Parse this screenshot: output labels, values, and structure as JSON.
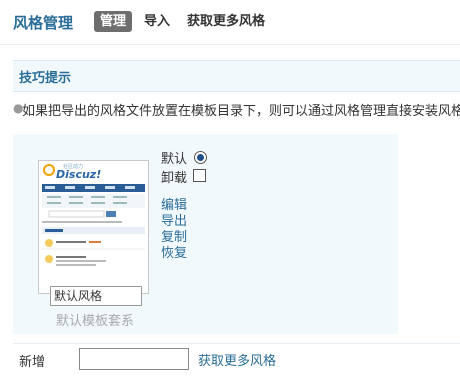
{
  "header": {
    "title": "风格管理",
    "tabs": [
      {
        "label": "管理",
        "active": true
      },
      {
        "label": "导入",
        "active": false
      },
      {
        "label": "获取更多风格",
        "active": false
      }
    ]
  },
  "tips": {
    "title": "技巧提示",
    "line": "如果把导出的风格文件放置在模板目录下，则可以通过风格管理直接安装风格"
  },
  "style": {
    "name_value": "默认风格",
    "subtitle": "默认模板套系",
    "options": {
      "default_label": "默认",
      "default_selected": true,
      "uninstall_label": "卸载",
      "uninstall_checked": false
    },
    "actions": [
      "编辑",
      "导出",
      "复制",
      "恢复"
    ],
    "thumbnail": {
      "brand": "Discuz!",
      "brand_sub": "社区动力",
      "icon": "discuz-forum-preview"
    }
  },
  "new": {
    "label": "新增",
    "input_value": "",
    "more_link": "获取更多风格"
  },
  "colors": {
    "accent": "#2a6d98",
    "tab_active_bg": "#6e6e6e",
    "panel_bg": "#f2f9fd"
  }
}
